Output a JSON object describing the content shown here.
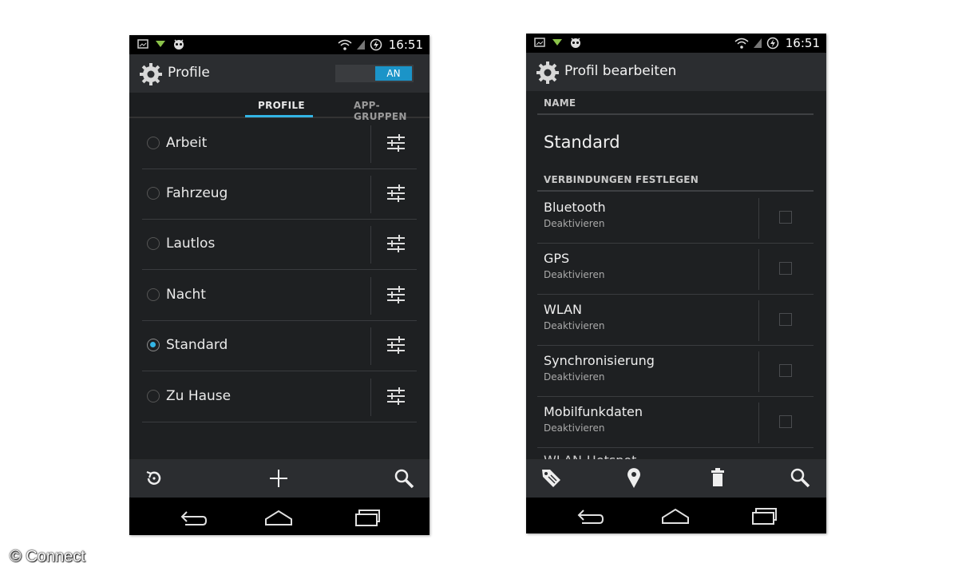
{
  "left_screen": {
    "status_time": "16:51",
    "title": "Profile",
    "toggle_label": "AN",
    "tabs": [
      {
        "label": "PROFILE",
        "active": true
      },
      {
        "label": "APP-GRUPPEN",
        "active": false
      }
    ],
    "profiles": [
      {
        "label": "Arbeit",
        "selected": false
      },
      {
        "label": "Fahrzeug",
        "selected": false
      },
      {
        "label": "Lautlos",
        "selected": false
      },
      {
        "label": "Nacht",
        "selected": false
      },
      {
        "label": "Standard",
        "selected": true
      },
      {
        "label": "Zu Hause",
        "selected": false
      }
    ],
    "bottom_actions": [
      "reset-icon",
      "add-icon",
      "search-icon"
    ]
  },
  "right_screen": {
    "status_time": "16:51",
    "title": "Profil bearbeiten",
    "name_header": "NAME",
    "name_value": "Standard",
    "connections_header": "VERBINDUNGEN FESTLEGEN",
    "connections": [
      {
        "title": "Bluetooth",
        "subtitle": "Deaktivieren",
        "checked": false
      },
      {
        "title": "GPS",
        "subtitle": "Deaktivieren",
        "checked": false
      },
      {
        "title": "WLAN",
        "subtitle": "Deaktivieren",
        "checked": false
      },
      {
        "title": "Synchronisierung",
        "subtitle": "Deaktivieren",
        "checked": false
      },
      {
        "title": "Mobilfunkdaten",
        "subtitle": "Deaktivieren",
        "checked": false
      }
    ],
    "partial_row": "WLAN-Hotspot",
    "bottom_actions": [
      "tag-icon",
      "location-pin-icon",
      "trash-icon",
      "search-icon"
    ]
  },
  "navigation": [
    "back-icon",
    "home-icon",
    "recent-apps-icon"
  ],
  "colors": {
    "accent": "#33b5e5",
    "toggle_on": "#1b94c8"
  },
  "watermark": "© Connect"
}
